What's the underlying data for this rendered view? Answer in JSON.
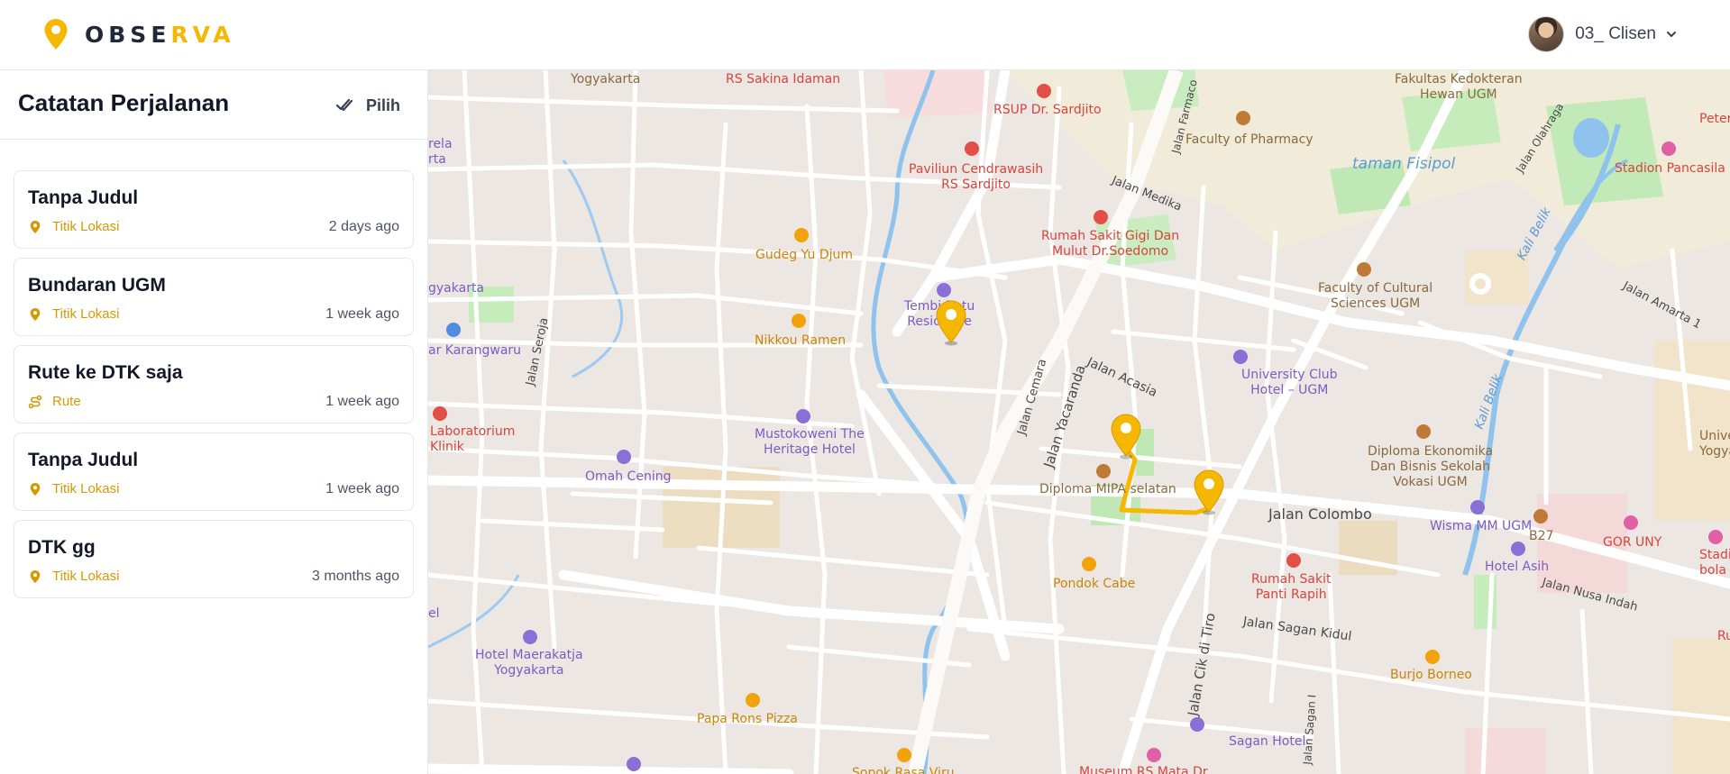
{
  "brand": {
    "name_prefix": "OBSE",
    "name_accent": "RVA",
    "accent_color": "#f5b700"
  },
  "user": {
    "name": "03_ Clisen"
  },
  "sidebar": {
    "title": "Catatan Perjalanan",
    "select_label": "Pilih",
    "items": [
      {
        "title": "Tanpa Judul",
        "type": "Titik Lokasi",
        "icon": "location-pin-icon",
        "time": "2 days ago"
      },
      {
        "title": "Bundaran UGM",
        "type": "Titik Lokasi",
        "icon": "location-pin-icon",
        "time": "1 week ago"
      },
      {
        "title": "Rute ke DTK saja",
        "type": "Rute",
        "icon": "route-icon",
        "time": "1 week ago"
      },
      {
        "title": "Tanpa Judul",
        "type": "Titik Lokasi",
        "icon": "location-pin-icon",
        "time": "1 week ago"
      },
      {
        "title": "DTK gg",
        "type": "Titik Lokasi",
        "icon": "location-pin-icon",
        "time": "3 months ago"
      }
    ]
  },
  "map": {
    "labels": {
      "yogyakarta_top": "Yogyakarta",
      "rs_sakina": "RS Sakina Idaman",
      "rsup": "RSUP Dr. Sardjito",
      "jalan_farmaco": "Jalan Farmaco",
      "faculty_pharmacy": "Faculty of Pharmacy",
      "fakultas_kedokteran": "Fakultas Kedokteran\nHewan UGM",
      "jalan_olahraga": "Jalan Olahraga",
      "peter": "Peter",
      "rela": "rela\nrta",
      "paviliun": "Paviliun Cendrawasih\nRS Sardjito",
      "jalan_medika": "Jalan Medika",
      "taman_fisipol": "taman Fisipol",
      "stadion_pancasila": "Stadion Pancasila",
      "kali_belik_1": "Kali Belik",
      "rs_gigi": "Rumah Sakit Gigi Dan\nMulut Dr.Soedomo",
      "gudeg": "Gudeg Yu Djum",
      "yogyakarta_left": "gyakarta",
      "faculty_cultural": "Faculty of Cultural\nSciences UGM",
      "jalan_amarta": "Jalan Amarta 1",
      "tembi": "Tembi Batu\nResidence",
      "nikkou": "Nikkou Ramen",
      "karangwaru": "ar Karangwaru",
      "jalan_seroja": "Jalan Seroja",
      "jalan_acasia": "Jalan Acasia",
      "jalan_cemara": "Jalan Cemara",
      "jalan_yacaranda": "Jalan Yacaranda",
      "university_club": "University Club\nHotel – UGM",
      "kali_belik_2": "Kali Belik",
      "laboratorium": "Laboratorium\nKlinik",
      "mustokoweni": "Mustokoweni The\nHeritage Hotel",
      "diploma_ekonomika": "Diploma Ekonomika\nDan Bisnis Sekolah\nVokasi UGM",
      "universi": "Universi\nYogya",
      "omah_cening": "Omah Cening",
      "diploma_mipa": "Diploma MIPA selatan",
      "jalan_colombo": "Jalan Colombo",
      "wisma_mm": "Wisma MM UGM",
      "b27": "B27",
      "gor_uny": "GOR UNY",
      "hotel_asih": "Hotel Asih",
      "stadion_sosial": "Stadion Sc\nbola dan At",
      "pondok_cabe": "Pondok Cabe",
      "rs_panti_rapih": "Rumah Sakit\nPanti Rapih",
      "jalan_nusa_indah": "Jalan Nusa Indah",
      "el": "el",
      "jalan_sagan_kidul": "Jalan Sagan Kidul",
      "jalan_cik_di_tiro": "Jalan Cik di Tiro",
      "hotel_maerakatja": "Hotel Maerakatja\nYogyakarta",
      "burjo": "Burjo Borneo",
      "ru": "Ru",
      "jalan_sagan_1": "Jalan Sagan I",
      "papa_rons": "Papa Rons Pizza",
      "sagan_hotel": "Sagan Hotel",
      "museum": "Museum RS Mata Dr",
      "soto": "Sopok Rasa Viru"
    }
  }
}
